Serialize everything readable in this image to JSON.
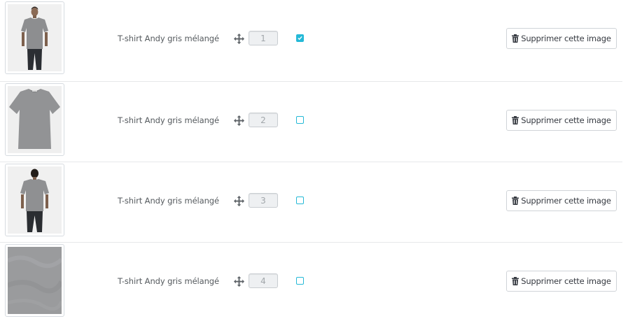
{
  "rows": [
    {
      "caption": "T-shirt Andy gris mélangé",
      "position": "1",
      "cover": true,
      "delete_label": "Supprimer cette image",
      "photo": "front-model",
      "icon_move": "move-arrows-icon",
      "icon_delete": "trash-icon"
    },
    {
      "caption": "T-shirt Andy gris mélangé",
      "position": "2",
      "cover": false,
      "delete_label": "Supprimer cette image",
      "photo": "flat-tshirt",
      "icon_move": "move-arrows-icon",
      "icon_delete": "trash-icon"
    },
    {
      "caption": "T-shirt Andy gris mélangé",
      "position": "3",
      "cover": false,
      "delete_label": "Supprimer cette image",
      "photo": "back-model",
      "icon_move": "move-arrows-icon",
      "icon_delete": "trash-icon"
    },
    {
      "caption": "T-shirt Andy gris mélangé",
      "position": "4",
      "cover": false,
      "delete_label": "Supprimer cette image",
      "photo": "fabric-swatch",
      "icon_move": "move-arrows-icon",
      "icon_delete": "trash-icon"
    }
  ],
  "colors": {
    "accent": "#25b9d7",
    "text": "#555a5e",
    "border": "#d6dbe0"
  }
}
